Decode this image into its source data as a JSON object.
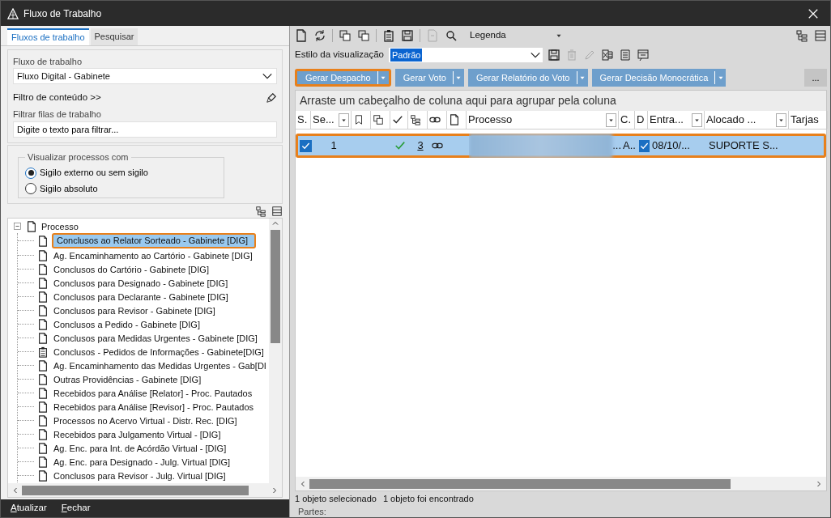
{
  "window": {
    "title": "Fluxo de Trabalho"
  },
  "left_tabs": [
    {
      "label": "Fluxos de trabalho",
      "selected": true
    },
    {
      "label": "Pesquisar",
      "selected": false
    }
  ],
  "workflow": {
    "label": "Fluxo de trabalho",
    "value": "Fluxo Digital - Gabinete"
  },
  "content_filter": {
    "label": "Filtro de conteúdo >>"
  },
  "queue_filter": {
    "label": "Filtrar filas de trabalho",
    "value": "Digite o texto para filtrar..."
  },
  "visibility": {
    "legend": "Visualizar processos com",
    "options": [
      {
        "label": "Sigilo externo ou sem sigilo",
        "selected": true
      },
      {
        "label": "Sigilo absoluto",
        "selected": false
      }
    ]
  },
  "tree": {
    "label": "Processo",
    "expanded": true,
    "children": [
      {
        "label": "Conclusos ao Relator Sorteado - Gabinete [DIG]",
        "kind": "queue",
        "selected": true,
        "highlighted": true
      },
      {
        "label": "Ag. Encaminhamento ao Cartório - Gabinete [DIG]",
        "kind": "queue",
        "selected": false,
        "highlighted": false
      },
      {
        "label": "Conclusos do Cartório - Gabinete [DIG]",
        "kind": "queue",
        "selected": false,
        "highlighted": false
      },
      {
        "label": "Conclusos para Designado - Gabinete [DIG]",
        "kind": "queue",
        "selected": false,
        "highlighted": false
      },
      {
        "label": "Conclusos para Declarante - Gabinete [DIG]",
        "kind": "queue",
        "selected": false,
        "highlighted": false
      },
      {
        "label": "Conclusos para Revisor - Gabinete [DIG]",
        "kind": "queue",
        "selected": false,
        "highlighted": false
      },
      {
        "label": "Conclusos a Pedido - Gabinete [DIG]",
        "kind": "queue",
        "selected": false,
        "highlighted": false
      },
      {
        "label": "Conclusos para Medidas Urgentes - Gabinete [DIG]",
        "kind": "queue",
        "selected": false,
        "highlighted": false
      },
      {
        "label": "Conclusos - Pedidos de Informações - Gabinete[DIG]",
        "kind": "clipboard",
        "selected": false,
        "highlighted": false
      },
      {
        "label": "Ag. Encaminhamento das Medidas Urgentes - Gab[DI",
        "kind": "queue",
        "selected": false,
        "highlighted": false
      },
      {
        "label": "Outras Providências - Gabinete [DIG]",
        "kind": "queue",
        "selected": false,
        "highlighted": false
      },
      {
        "label": "Recebidos para Análise [Relator] - Proc. Pautados",
        "kind": "queue",
        "selected": false,
        "highlighted": false
      },
      {
        "label": "Recebidos para Análise [Revisor] - Proc. Pautados",
        "kind": "queue",
        "selected": false,
        "highlighted": false
      },
      {
        "label": "Processos no Acervo Virtual - Distr. Rec. [DIG]",
        "kind": "queue",
        "selected": false,
        "highlighted": false
      },
      {
        "label": "Recebidos para Julgamento Virtual - [DIG]",
        "kind": "queue",
        "selected": false,
        "highlighted": false
      },
      {
        "label": "Ag. Enc. para Int. de Acórdão Virtual - [DIG]",
        "kind": "queue",
        "selected": false,
        "highlighted": false
      },
      {
        "label": "Ag. Enc. para Designado - Julg. Virtual [DIG]",
        "kind": "queue",
        "selected": false,
        "highlighted": false
      },
      {
        "label": "Conclusos para Revisor - Julg. Virtual [DIG]",
        "kind": "queue",
        "selected": false,
        "highlighted": false
      }
    ]
  },
  "bottom_buttons": [
    "Atualizar",
    "Fechar"
  ],
  "legend_dropdown": {
    "value": "Legenda"
  },
  "view_style": {
    "label": "Estilo da visualização",
    "value": "Padrão"
  },
  "action_buttons": [
    {
      "label": "Gerar Despacho",
      "highlighted": true
    },
    {
      "label": "Gerar Voto",
      "highlighted": false
    },
    {
      "label": "Gerar Relatório do Voto",
      "highlighted": false
    },
    {
      "label": "Gerar Decisão Monocrática",
      "highlighted": false
    }
  ],
  "more_button": "...",
  "grid": {
    "group_hint": "Arraste um cabeçalho de coluna aqui para agrupar pela coluna",
    "columns": [
      {
        "kind": "text",
        "label": "S.",
        "filter": false
      },
      {
        "kind": "text",
        "label": "Se...",
        "filter": true
      },
      {
        "kind": "icon",
        "filter": false
      },
      {
        "kind": "icon",
        "filter": false
      },
      {
        "kind": "icon",
        "filter": false
      },
      {
        "kind": "icon",
        "filter": false
      },
      {
        "kind": "icon",
        "filter": false
      },
      {
        "kind": "icon",
        "filter": false
      },
      {
        "kind": "text",
        "label": "Processo",
        "filter": true
      },
      {
        "kind": "text",
        "label": "C.",
        "filter": false
      },
      {
        "kind": "text",
        "label": "D",
        "filter": false
      },
      {
        "kind": "text",
        "label": "Entra...",
        "filter": true
      },
      {
        "kind": "text",
        "label": "Alocado ...",
        "filter": true
      },
      {
        "kind": "text",
        "label": "Tarjas",
        "filter": false
      }
    ],
    "rows": [
      {
        "selected": true,
        "highlighted": true,
        "checked": true,
        "sequence": "1",
        "done": true,
        "count": "3",
        "linked": true,
        "process_tail": "...",
        "column_c": "A..",
        "d_checked": true,
        "entry": "08/10/...",
        "allocated": "SUPORTE S..."
      }
    ]
  },
  "status_bar": [
    "1 objeto selecionado",
    "1 objeto foi encontrado"
  ],
  "parts": {
    "label": "Partes:"
  }
}
